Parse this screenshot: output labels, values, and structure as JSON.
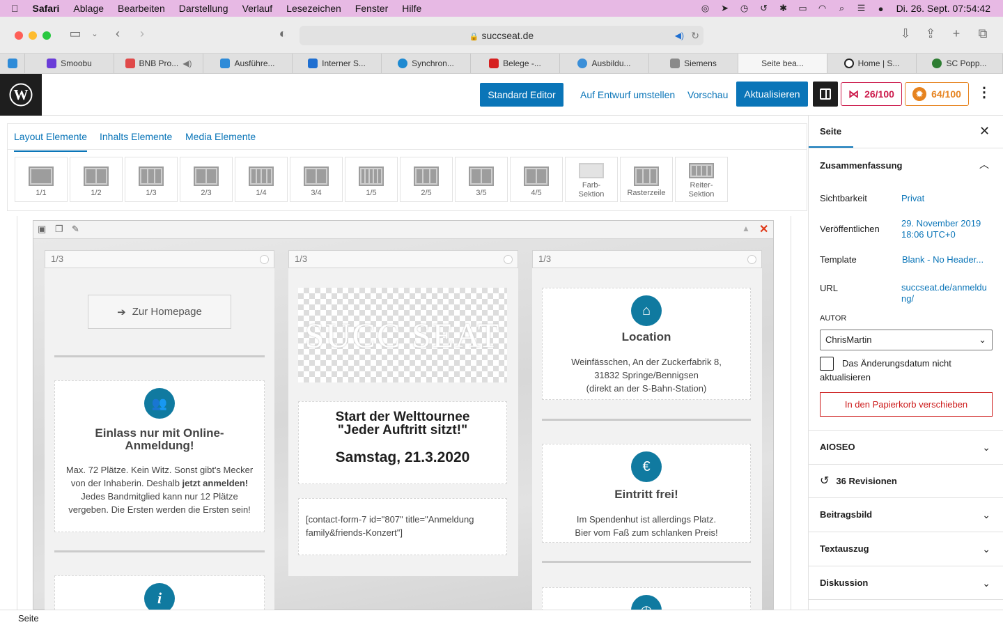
{
  "menubar": {
    "app": "Safari",
    "items": [
      "Ablage",
      "Bearbeiten",
      "Darstellung",
      "Verlauf",
      "Lesezeichen",
      "Fenster",
      "Hilfe"
    ],
    "datetime": "Di. 26. Sept.  07:54:42"
  },
  "browser": {
    "url": "succseat.de",
    "tabs": [
      {
        "label": "",
        "color": "#2e8bd8"
      },
      {
        "label": "Smoobu",
        "color": "#6a3cd8"
      },
      {
        "label": "BNB Pro...",
        "color": "#e04a4a"
      },
      {
        "label": "Ausführe...",
        "color": "#2e8bd8"
      },
      {
        "label": "Interner S...",
        "color": "#1f6fd1"
      },
      {
        "label": "Synchron...",
        "color": "#1f8ad1"
      },
      {
        "label": "Belege -...",
        "color": "#d62020"
      },
      {
        "label": "Ausbildu...",
        "color": "#3b8fd8"
      },
      {
        "label": "Siemens",
        "color": "#8a8a8a"
      },
      {
        "label": "Seite bea...",
        "color": ""
      },
      {
        "label": "Home | S...",
        "color": "#222222"
      },
      {
        "label": "SC Popp...",
        "color": "#2e7d32"
      }
    ]
  },
  "header": {
    "standard_editor": "Standard Editor",
    "draft": "Auf Entwurf umstellen",
    "preview": "Vorschau",
    "update": "Aktualisieren",
    "score1": "26/100",
    "score2": "64/100"
  },
  "builder": {
    "tabs": [
      "Layout Elemente",
      "Inhalts Elemente",
      "Media Elemente"
    ],
    "layouts": [
      {
        "label": "1/1",
        "cols": 1
      },
      {
        "label": "1/2",
        "cols": 2
      },
      {
        "label": "1/3",
        "cols": 3
      },
      {
        "label": "2/3",
        "cols": 2
      },
      {
        "label": "1/4",
        "cols": 4
      },
      {
        "label": "3/4",
        "cols": 2
      },
      {
        "label": "1/5",
        "cols": 5
      },
      {
        "label": "2/5",
        "cols": 3
      },
      {
        "label": "3/5",
        "cols": 2
      },
      {
        "label": "4/5",
        "cols": 2
      },
      {
        "label": "Farb-\nSektion",
        "cols": 0
      },
      {
        "label": "Rasterzeile",
        "cols": 3
      },
      {
        "label": "Reiter-\nSektion",
        "cols": 4
      }
    ]
  },
  "canvas": {
    "col1": {
      "head": "1/3",
      "button": "Zur Homepage",
      "card_title": "Einlass nur mit Online-Anmeldung!",
      "card_text_a": "Max. 72 Plätze. Kein Witz. Sonst gibt's Mecker von der Inhaberin. Deshalb ",
      "card_text_bold": "jetzt anmelden!",
      "card_text_b": " Jedes Bandmitglied kann nur 12 Plätze vergeben. Die Ersten werden die Ersten sein!"
    },
    "col2": {
      "head": "1/3",
      "logo_text": "SUCC SEAT",
      "title1": "Start der Welttournee",
      "title2": "\"Jeder Auftritt sitzt!\"",
      "date": "Samstag, 21.3.2020",
      "shortcode": "[contact-form-7 id=\"807\" title=\"Anmeldung family&friends-Konzert\"]"
    },
    "col3": {
      "head": "1/3",
      "loc_title": "Location",
      "loc_text1": "Weinfässchen, An der Zuckerfabrik 8,",
      "loc_text2": "31832 Springe/Bennigsen",
      "loc_text3": "(direkt an der S-Bahn-Station)",
      "free_title": "Eintritt frei!",
      "free_text1": "Im Spendenhut ist allerdings Platz.",
      "free_text2": "Bier vom Faß zum schlanken Preis!"
    }
  },
  "sidebar": {
    "tab": "Seite",
    "summary": "Zusammenfassung",
    "visibility_label": "Sichtbarkeit",
    "visibility_value": "Privat",
    "publish_label": "Veröffentlichen",
    "publish_value": "29. November 2019 18:06 UTC+0",
    "template_label": "Template",
    "template_value": "Blank - No Header...",
    "url_label": "URL",
    "url_value": "succseat.de/anmeldung/",
    "author_label": "AUTOR",
    "author_value": "ChrisMartin",
    "checkbox_label": "Das Änderungsdatum nicht aktualisieren",
    "trash": "In den Papierkorb verschieben",
    "aioseo": "AIOSEO",
    "revisions": "36 Revisionen",
    "featured": "Beitragsbild",
    "excerpt": "Textauszug",
    "discussion": "Diskussion"
  },
  "status": {
    "breadcrumb": "Seite"
  },
  "colors": {
    "accent": "#0a75b8",
    "icon_bg": "#107aa0",
    "danger": "#cc1818",
    "score_red": "#cc1a4b",
    "score_orange": "#e6831f"
  }
}
